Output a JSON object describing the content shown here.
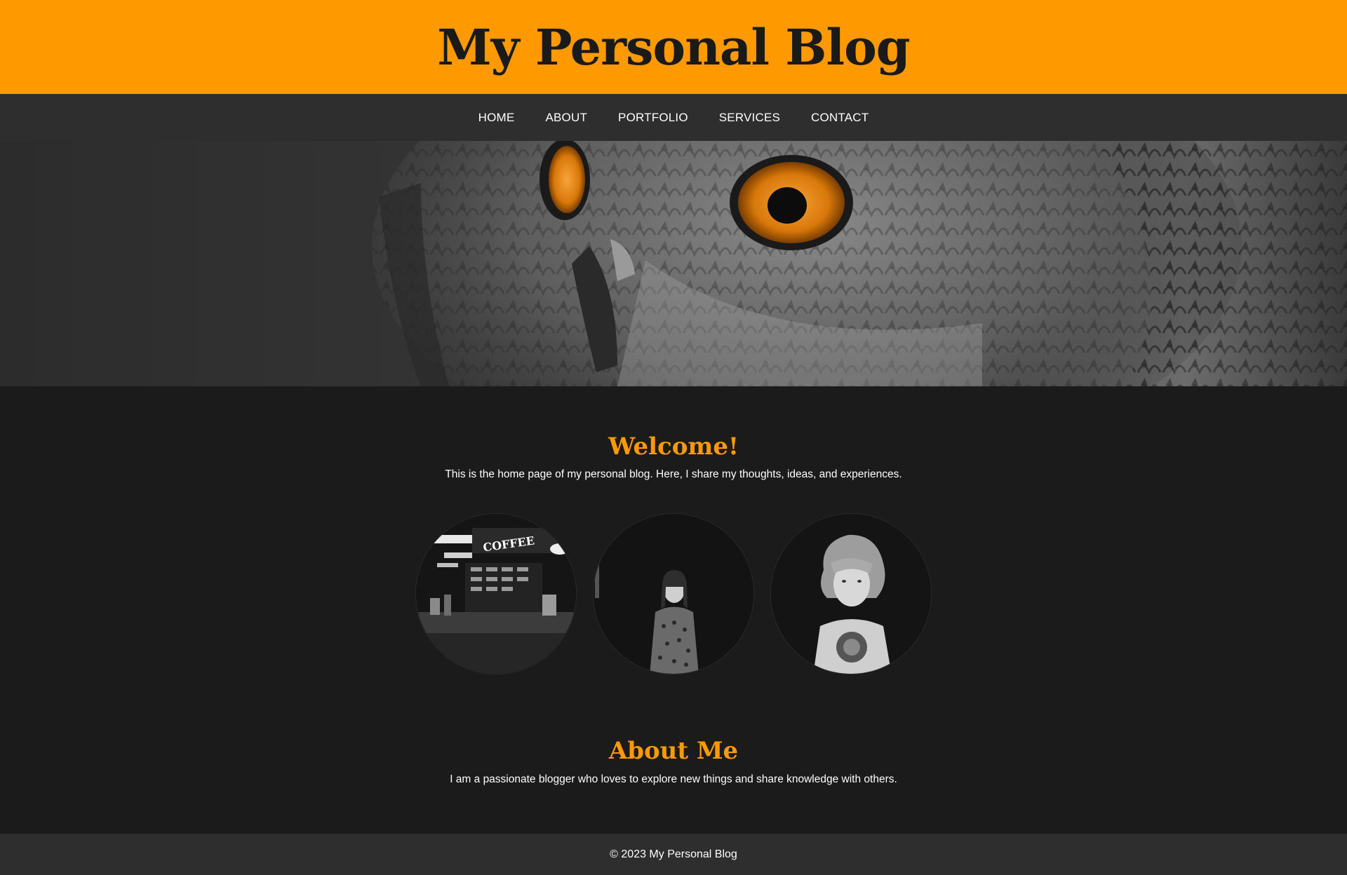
{
  "header": {
    "title": "My Personal Blog",
    "background_color": "#ff9900"
  },
  "nav": {
    "items": [
      {
        "label": "HOME"
      },
      {
        "label": "ABOUT"
      },
      {
        "label": "PORTFOLIO"
      },
      {
        "label": "SERVICES"
      },
      {
        "label": "CONTACT"
      }
    ]
  },
  "hero": {
    "image": "owl-closeup-orange-eyes"
  },
  "welcome": {
    "heading": "Welcome!",
    "text": "This is the home page of my personal blog. Here, I share my thoughts, ideas, and experiences."
  },
  "gallery": {
    "images": [
      {
        "image": "coffee-shop-interior",
        "sign_text": "COFFEE"
      },
      {
        "image": "woman-portrait"
      },
      {
        "image": "man-portrait"
      }
    ]
  },
  "about": {
    "heading": "About Me",
    "text": "I am a passionate blogger who loves to explore new things and share knowledge with others."
  },
  "footer": {
    "text": "© 2023 My Personal Blog"
  },
  "colors": {
    "accent": "#ff9900",
    "nav_background": "#2e2e2e",
    "page_background": "#1b1b1b"
  }
}
